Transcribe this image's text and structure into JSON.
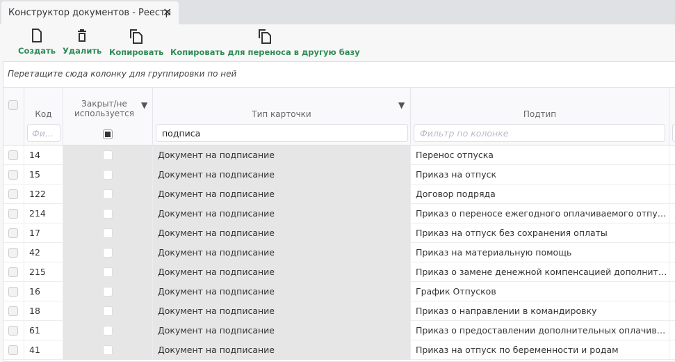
{
  "tab": {
    "title": "Конструктор документов - Реестр",
    "close": "✕"
  },
  "toolbar": {
    "create": "Создать",
    "delete": "Удалить",
    "copy": "Копировать",
    "copy_transfer": "Копировать для переноса в другую базу"
  },
  "group_panel": "Перетащите сюда колонку для группировки по ней",
  "columns": {
    "code": "Код",
    "closed": "Закрыт/не используется",
    "card_type": "Тип карточки",
    "subtype": "Подтип"
  },
  "filters": {
    "code_placeholder": "Фи...",
    "card_type_value": "подписа",
    "subtype_placeholder": "Фильтр по колонке"
  },
  "rows": [
    {
      "code": "14",
      "type": "Документ на подписание",
      "subtype": "Перенос отпуска"
    },
    {
      "code": "15",
      "type": "Документ на подписание",
      "subtype": "Приказ на отпуск"
    },
    {
      "code": "122",
      "type": "Документ на подписание",
      "subtype": "Договор подряда"
    },
    {
      "code": "214",
      "type": "Документ на подписание",
      "subtype": "Приказ о переносе ежегодного оплачиваемого отпуска"
    },
    {
      "code": "17",
      "type": "Документ на подписание",
      "subtype": "Приказ на отпуск без сохранения оплаты"
    },
    {
      "code": "42",
      "type": "Документ на подписание",
      "subtype": "Приказ на материальную помощь"
    },
    {
      "code": "215",
      "type": "Документ на подписание",
      "subtype": "Приказ о замене денежной компенсацией дополнительного отпуска"
    },
    {
      "code": "16",
      "type": "Документ на подписание",
      "subtype": "График Отпусков"
    },
    {
      "code": "18",
      "type": "Документ на подписание",
      "subtype": "Приказ о направлении в командировку"
    },
    {
      "code": "61",
      "type": "Документ на подписание",
      "subtype": "Приказ о предоставлении дополнительных оплачиваемых дней"
    },
    {
      "code": "41",
      "type": "Документ на подписание",
      "subtype": "Приказ на отпуск по беременности и родам"
    }
  ]
}
